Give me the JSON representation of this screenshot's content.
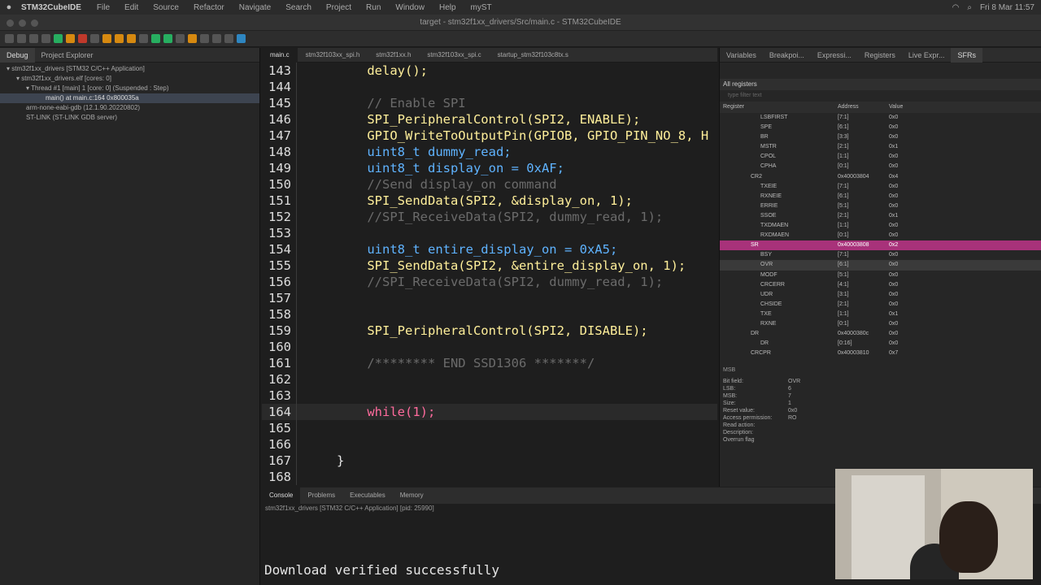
{
  "menubar": {
    "app_name": "STM32CubeIDE",
    "items": [
      "File",
      "Edit",
      "Source",
      "Refactor",
      "Navigate",
      "Search",
      "Project",
      "Run",
      "Window",
      "Help",
      "myST"
    ],
    "datetime": "Fri 8 Mar  11:57"
  },
  "window": {
    "title": "target - stm32f1xx_drivers/Src/main.c - STM32CubeIDE"
  },
  "left": {
    "tabs": [
      "Debug",
      "Project Explorer"
    ],
    "tree": [
      "stm32f1xx_drivers [STM32 C/C++ Application]",
      "stm32f1xx_drivers.elf [cores: 0]",
      "Thread #1 [main] 1 [core: 0] (Suspended : Step)",
      "main() at main.c:164 0x800035a",
      "arm-none-eabi-gdb (12.1.90.20220802)",
      "ST-LINK (ST-LINK GDB server)"
    ]
  },
  "editor": {
    "tabs": [
      "main.c",
      "stm32f103xx_spi.h",
      "stm32f1xx.h",
      "stm32f103xx_spi.c",
      "startup_stm32f103c8tx.s"
    ],
    "lines": [
      {
        "n": "143",
        "code": "    delay();"
      },
      {
        "n": "144",
        "code": ""
      },
      {
        "n": "145",
        "code": "    // Enable SPI"
      },
      {
        "n": "146",
        "code": "    SPI_PeripheralControl(SPI2, ENABLE);"
      },
      {
        "n": "147",
        "code": "    GPIO_WriteToOutputPin(GPIOB, GPIO_PIN_NO_8, H"
      },
      {
        "n": "148",
        "code": "    uint8_t dummy_read;"
      },
      {
        "n": "149",
        "code": "    uint8_t display_on = 0xAF;"
      },
      {
        "n": "150",
        "code": "    //Send display_on command"
      },
      {
        "n": "151",
        "code": "    SPI_SendData(SPI2, &display_on, 1);"
      },
      {
        "n": "152",
        "code": "    //SPI_ReceiveData(SPI2, dummy_read, 1);"
      },
      {
        "n": "153",
        "code": ""
      },
      {
        "n": "154",
        "code": "    uint8_t entire_display_on = 0xA5;"
      },
      {
        "n": "155",
        "code": "    SPI_SendData(SPI2, &entire_display_on, 1);"
      },
      {
        "n": "156",
        "code": "    //SPI_ReceiveData(SPI2, dummy_read, 1);"
      },
      {
        "n": "157",
        "code": ""
      },
      {
        "n": "158",
        "code": ""
      },
      {
        "n": "159",
        "code": "    SPI_PeripheralControl(SPI2, DISABLE);"
      },
      {
        "n": "160",
        "code": ""
      },
      {
        "n": "161",
        "code": "    /******** END SSD1306 *******/"
      },
      {
        "n": "162",
        "code": ""
      },
      {
        "n": "163",
        "code": ""
      },
      {
        "n": "164",
        "code": "    while(1);"
      },
      {
        "n": "165",
        "code": ""
      },
      {
        "n": "166",
        "code": ""
      },
      {
        "n": "167",
        "code": "}"
      },
      {
        "n": "168",
        "code": ""
      }
    ]
  },
  "right": {
    "tabs": [
      "Variables",
      "Breakpoi...",
      "Expressi...",
      "Registers",
      "Live Expr...",
      "SFRs"
    ],
    "section": "All registers",
    "filter_placeholder": "type filter text",
    "columns": [
      "Register",
      "Address",
      "Value"
    ],
    "rows": [
      [
        "LSBFIRST",
        "[7:1]",
        "0x0"
      ],
      [
        "SPE",
        "[6:1]",
        "0x0"
      ],
      [
        "BR",
        "[3:3]",
        "0x0"
      ],
      [
        "MSTR",
        "[2:1]",
        "0x1"
      ],
      [
        "CPOL",
        "[1:1]",
        "0x0"
      ],
      [
        "CPHA",
        "[0:1]",
        "0x0"
      ],
      [
        "CR2",
        "0x40003804",
        "0x4"
      ],
      [
        "TXEIE",
        "[7:1]",
        "0x0"
      ],
      [
        "RXNEIE",
        "[6:1]",
        "0x0"
      ],
      [
        "ERRIE",
        "[5:1]",
        "0x0"
      ],
      [
        "SSOE",
        "[2:1]",
        "0x1"
      ],
      [
        "TXDMAEN",
        "[1:1]",
        "0x0"
      ],
      [
        "RXDMAEN",
        "[0:1]",
        "0x0"
      ],
      [
        "SR",
        "0x40003808",
        "0x2"
      ],
      [
        "BSY",
        "[7:1]",
        "0x0"
      ],
      [
        "OVR",
        "[6:1]",
        "0x0"
      ],
      [
        "MODF",
        "[5:1]",
        "0x0"
      ],
      [
        "CRCERR",
        "[4:1]",
        "0x0"
      ],
      [
        "UDR",
        "[3:1]",
        "0x0"
      ],
      [
        "CHSIDE",
        "[2:1]",
        "0x0"
      ],
      [
        "TXE",
        "[1:1]",
        "0x1"
      ],
      [
        "RXNE",
        "[0:1]",
        "0x0"
      ],
      [
        "DR",
        "0x4000380c",
        "0x0"
      ],
      [
        "DR",
        "[0:16]",
        "0x0"
      ],
      [
        "CRCPR",
        "0x40003810",
        "0x7"
      ]
    ],
    "msb_label": "MSB",
    "bitfield": [
      [
        "Bit field:",
        "OVR"
      ],
      [
        "LSB:",
        "6"
      ],
      [
        "MSB:",
        "7"
      ],
      [
        "Size:",
        "1"
      ],
      [
        "Reset value:",
        "0x0"
      ],
      [
        "Access permission:",
        "RO"
      ],
      [
        "Read action:",
        ""
      ],
      [
        "",
        ""
      ],
      [
        "Description:",
        ""
      ],
      [
        "Overrun flag",
        ""
      ]
    ]
  },
  "bottom": {
    "tabs": [
      "Console",
      "Problems",
      "Executables",
      "Memory"
    ],
    "subtitle": "stm32f1xx_drivers [STM32 C/C++ Application] [pid: 25990]",
    "message": "Download verified successfully"
  }
}
